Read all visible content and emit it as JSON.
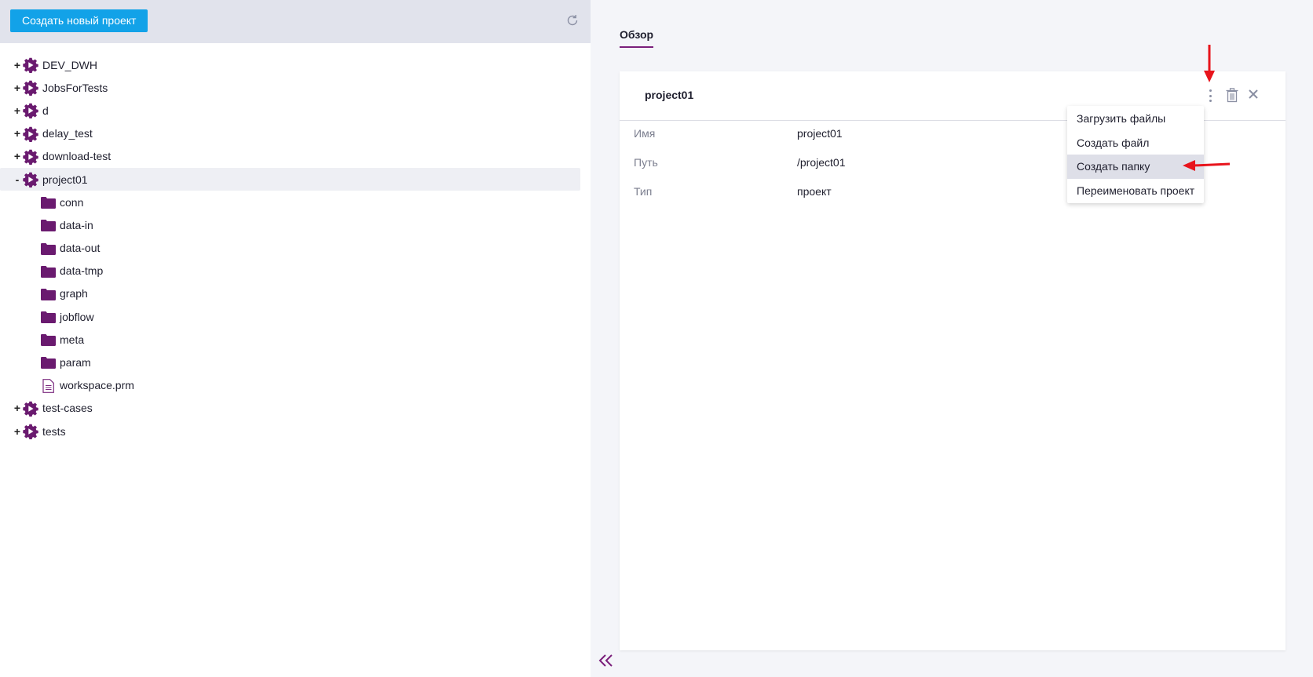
{
  "toolbar": {
    "create_button": "Создать новый проект",
    "refresh_icon": "refresh-icon"
  },
  "tree": {
    "projects_before": [
      {
        "toggle": "+",
        "label": "DEV_DWH"
      },
      {
        "toggle": "+",
        "label": "JobsForTests"
      },
      {
        "toggle": "+",
        "label": "d"
      },
      {
        "toggle": "+",
        "label": "delay_test"
      },
      {
        "toggle": "+",
        "label": "download-test"
      }
    ],
    "selected_project": {
      "toggle": "-",
      "label": "project01"
    },
    "children": [
      {
        "type": "folder",
        "label": "conn"
      },
      {
        "type": "folder",
        "label": "data-in"
      },
      {
        "type": "folder",
        "label": "data-out"
      },
      {
        "type": "folder",
        "label": "data-tmp"
      },
      {
        "type": "folder",
        "label": "graph"
      },
      {
        "type": "folder",
        "label": "jobflow"
      },
      {
        "type": "folder",
        "label": "meta"
      },
      {
        "type": "folder",
        "label": "param"
      },
      {
        "type": "file",
        "label": "workspace.prm"
      }
    ],
    "projects_after": [
      {
        "toggle": "+",
        "label": "test-cases"
      },
      {
        "toggle": "+",
        "label": "tests"
      }
    ]
  },
  "details": {
    "tab": "Обзор",
    "title": "project01",
    "properties": [
      {
        "key": "Имя",
        "value": "project01"
      },
      {
        "key": "Путь",
        "value": "/project01"
      },
      {
        "key": "Тип",
        "value": "проект"
      }
    ]
  },
  "menu": {
    "items": [
      {
        "label": "Загрузить файлы",
        "active": false
      },
      {
        "label": "Создать файл",
        "active": false
      },
      {
        "label": "Создать папку",
        "active": true
      },
      {
        "label": "Переименовать проект",
        "active": false
      }
    ]
  },
  "colors": {
    "accent": "#7b1f7b",
    "primary_button": "#12a2e8",
    "toolbar_bg": "#e1e3ec",
    "annotation_arrow": "#e8141c"
  }
}
